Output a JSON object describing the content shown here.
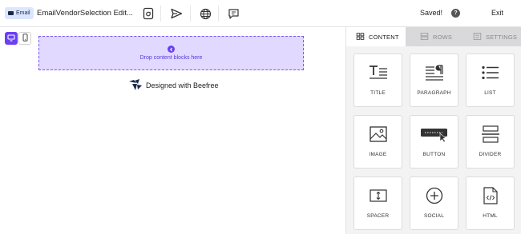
{
  "topbar": {
    "badge_label": "Email",
    "title": "EmailVendorSelection Edit...",
    "saved_label": "Saved!",
    "help_label": "?",
    "exit_label": "Exit",
    "icons": [
      "template-icon",
      "send-icon",
      "globe-icon",
      "comment-icon"
    ]
  },
  "devices": [
    "desktop-icon",
    "mobile-icon"
  ],
  "canvas": {
    "drop_text": "Drop content blocks here",
    "brand_text": "Designed with Beefree"
  },
  "panel": {
    "tabs": [
      {
        "label": "CONTENT",
        "icon": "grid-icon",
        "active": true
      },
      {
        "label": "ROWS",
        "icon": "rows-icon",
        "active": false
      },
      {
        "label": "SETTINGS",
        "icon": "settings-icon",
        "active": false
      }
    ],
    "blocks": [
      {
        "label": "TITLE",
        "icon": "title-icon"
      },
      {
        "label": "PARAGRAPH",
        "icon": "paragraph-icon"
      },
      {
        "label": "LIST",
        "icon": "list-icon"
      },
      {
        "label": "IMAGE",
        "icon": "image-icon"
      },
      {
        "label": "BUTTON",
        "icon": "button-icon"
      },
      {
        "label": "DIVIDER",
        "icon": "divider-icon"
      },
      {
        "label": "SPACER",
        "icon": "spacer-icon"
      },
      {
        "label": "SOCIAL",
        "icon": "social-icon"
      },
      {
        "label": "HTML",
        "icon": "html-icon"
      }
    ]
  },
  "colors": {
    "accent": "#6b3ff2",
    "dropzone_bg": "#e1d9ff",
    "badge_bg": "#dbe6ff",
    "panel_bg": "#f3f3f4"
  }
}
